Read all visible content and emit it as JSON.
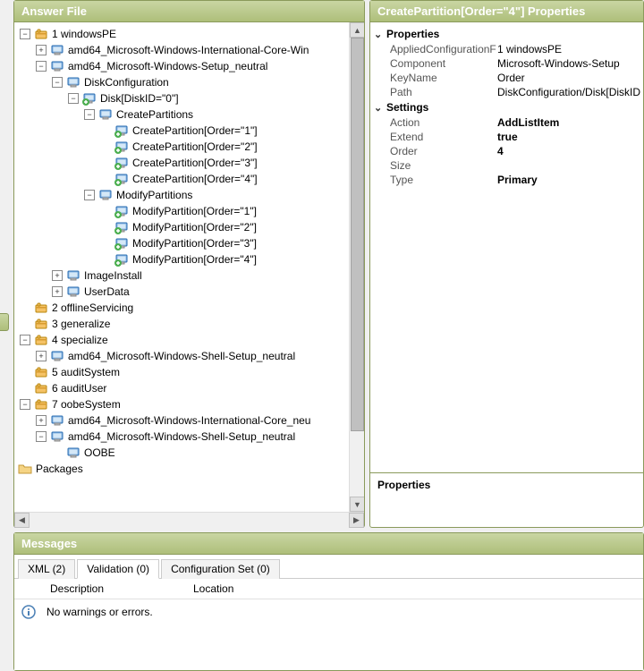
{
  "panels": {
    "answer_title": "Answer File",
    "props_title": "CreatePartition[Order=\"4\"] Properties",
    "messages_title": "Messages",
    "prop_desc_label": "Properties"
  },
  "tree": {
    "windowsPE": "1 windowsPE",
    "intl_core": "amd64_Microsoft-Windows-International-Core-Win",
    "setup_neutral": "amd64_Microsoft-Windows-Setup_neutral",
    "disk_config": "DiskConfiguration",
    "disk0": "Disk[DiskID=\"0\"]",
    "create_parts": "CreatePartitions",
    "cp1": "CreatePartition[Order=\"1\"]",
    "cp2": "CreatePartition[Order=\"2\"]",
    "cp3": "CreatePartition[Order=\"3\"]",
    "cp4": "CreatePartition[Order=\"4\"]",
    "modify_parts": "ModifyPartitions",
    "mp1": "ModifyPartition[Order=\"1\"]",
    "mp2": "ModifyPartition[Order=\"2\"]",
    "mp3": "ModifyPartition[Order=\"3\"]",
    "mp4": "ModifyPartition[Order=\"4\"]",
    "image_install": "ImageInstall",
    "user_data": "UserData",
    "offline": "2 offlineServicing",
    "generalize": "3 generalize",
    "specialize": "4 specialize",
    "shell_setup": "amd64_Microsoft-Windows-Shell-Setup_neutral",
    "audit_sys": "5 auditSystem",
    "audit_user": "6 auditUser",
    "oobe_sys": "7 oobeSystem",
    "intl_core2": "amd64_Microsoft-Windows-International-Core_neu",
    "shell_setup2": "amd64_Microsoft-Windows-Shell-Setup_neutral",
    "oobe": "OOBE",
    "packages": "Packages"
  },
  "props": {
    "section1": "Properties",
    "applied_k": "AppliedConfigurationF",
    "applied_v": "1 windowsPE",
    "component_k": "Component",
    "component_v": "Microsoft-Windows-Setup",
    "keyname_k": "KeyName",
    "keyname_v": "Order",
    "path_k": "Path",
    "path_v": "DiskConfiguration/Disk[DiskID",
    "section2": "Settings",
    "action_k": "Action",
    "action_v": "AddListItem",
    "extend_k": "Extend",
    "extend_v": "true",
    "order_k": "Order",
    "order_v": "4",
    "size_k": "Size",
    "size_v": "",
    "type_k": "Type",
    "type_v": "Primary"
  },
  "msgs": {
    "tab_xml": "XML (2)",
    "tab_validation": "Validation (0)",
    "tab_config": "Configuration Set (0)",
    "col_desc": "Description",
    "col_loc": "Location",
    "no_warnings": "No warnings or errors."
  }
}
